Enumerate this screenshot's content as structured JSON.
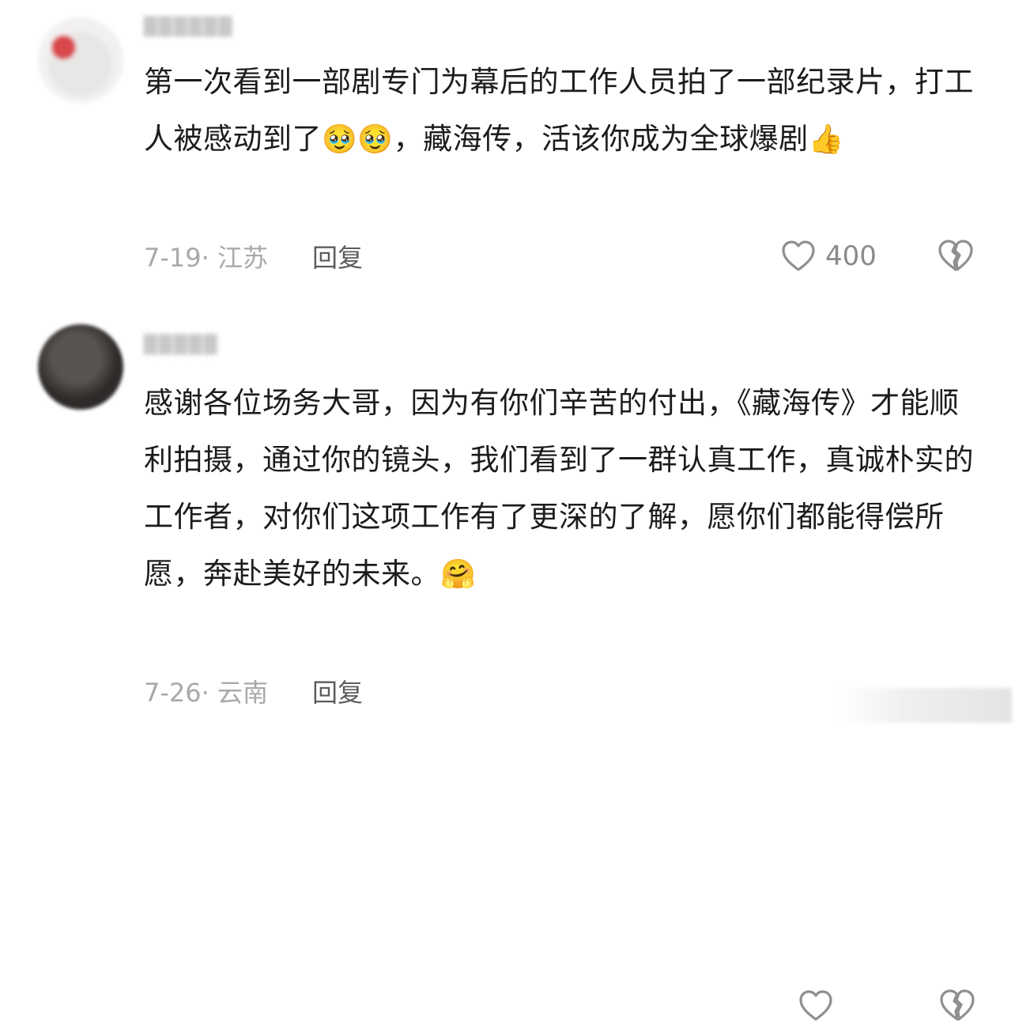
{
  "comments": [
    {
      "avatar_icon": "avatar-blurred",
      "text_before": "第一次看到一部剧专门为幕后的工作人员拍了一部纪录片，打工人被感动到了",
      "emoji_1": "🥹🥹",
      "text_after": "，藏海传，活该你成为全球爆剧",
      "emoji_2": "👍",
      "date_location": "7-19· 江苏",
      "reply_label": "回复",
      "like_count": "400",
      "like_icon": "heart-outline-icon",
      "dislike_icon": "broken-heart-icon"
    },
    {
      "avatar_icon": "avatar-blurred",
      "text_before": "感谢各位场务大哥，因为有你们辛苦的付出，《藏海传》才能顺利拍摄，通过你的镜头，我们看到了一群认真工作，真诚朴实的工作者，对你们这项工作有了更深的了解，愿你们都能得偿所愿，奔赴美好的未来。",
      "emoji_1": "🤗",
      "date_location": "7-26· 云南",
      "reply_label": "回复",
      "like_icon": "heart-outline-icon",
      "dislike_icon": "broken-heart-icon"
    }
  ]
}
